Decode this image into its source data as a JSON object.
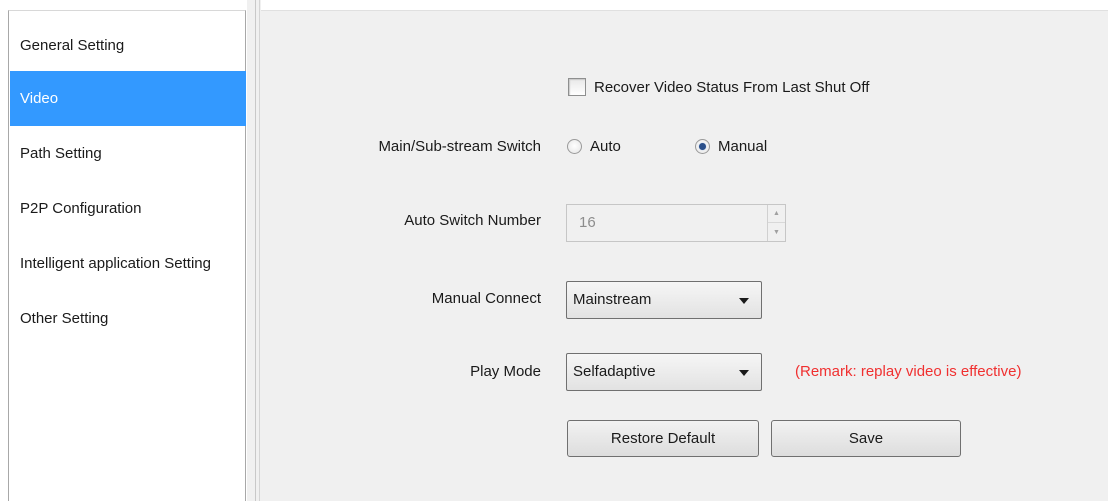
{
  "sidebar": {
    "items": [
      {
        "label": "General Setting"
      },
      {
        "label": "Video"
      },
      {
        "label": "Path Setting"
      },
      {
        "label": "P2P Configuration"
      },
      {
        "label": "Intelligent application Setting"
      },
      {
        "label": "Other Setting"
      }
    ],
    "active_index": 1
  },
  "settings": {
    "recover_label": "Recover Video Status From Last Shut Off",
    "recover_checked": false,
    "stream_switch_label": "Main/Sub-stream Switch",
    "stream_switch_options": [
      "Auto",
      "Manual"
    ],
    "stream_switch_selected": "Manual",
    "auto_switch_label": "Auto Switch Number",
    "auto_switch_value": "16",
    "manual_connect_label": "Manual Connect",
    "manual_connect_value": "Mainstream",
    "play_mode_label": "Play Mode",
    "play_mode_value": "Selfadaptive",
    "remark": "(Remark: replay video is effective)"
  },
  "buttons": {
    "restore_default": "Restore Default",
    "save": "Save"
  },
  "colors": {
    "active_item_bg": "#3399ff",
    "remark_text": "#f03030",
    "panel_bg": "#f0f0f0"
  }
}
